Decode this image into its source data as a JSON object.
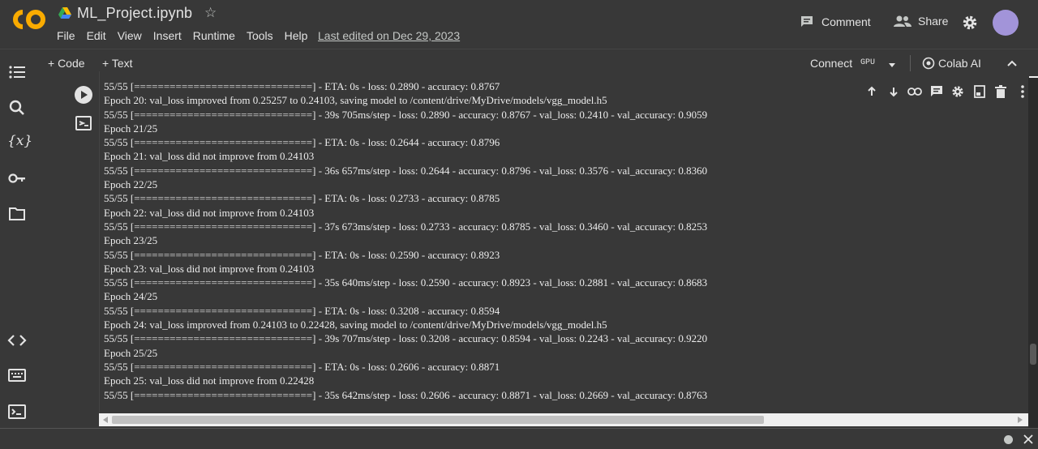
{
  "header": {
    "title": "ML_Project.ipynb",
    "menu": [
      "File",
      "Edit",
      "View",
      "Insert",
      "Runtime",
      "Tools",
      "Help"
    ],
    "last_edited": "Last edited on Dec 29, 2023",
    "comment_label": "Comment",
    "share_label": "Share",
    "logo_icon": "colab-logo-icon",
    "accent": "#f9ab00"
  },
  "toolbar": {
    "add_code": "+ Code",
    "add_text": "+ Text",
    "connect": "Connect",
    "runtime_type": "GPU",
    "colab_ai": "Colab AI"
  },
  "cell": {
    "output_lines": [
      "55/55 [==============================] - ETA: 0s - loss: 0.2890 - accuracy: 0.8767",
      "Epoch 20: val_loss improved from 0.25257 to 0.24103, saving model to /content/drive/MyDrive/models/vgg_model.h5",
      "55/55 [==============================] - 39s 705ms/step - loss: 0.2890 - accuracy: 0.8767 - val_loss: 0.2410 - val_accuracy: 0.9059",
      "Epoch 21/25",
      "55/55 [==============================] - ETA: 0s - loss: 0.2644 - accuracy: 0.8796",
      "Epoch 21: val_loss did not improve from 0.24103",
      "55/55 [==============================] - 36s 657ms/step - loss: 0.2644 - accuracy: 0.8796 - val_loss: 0.3576 - val_accuracy: 0.8360",
      "Epoch 22/25",
      "55/55 [==============================] - ETA: 0s - loss: 0.2733 - accuracy: 0.8785",
      "Epoch 22: val_loss did not improve from 0.24103",
      "55/55 [==============================] - 37s 673ms/step - loss: 0.2733 - accuracy: 0.8785 - val_loss: 0.3460 - val_accuracy: 0.8253",
      "Epoch 23/25",
      "55/55 [==============================] - ETA: 0s - loss: 0.2590 - accuracy: 0.8923",
      "Epoch 23: val_loss did not improve from 0.24103",
      "55/55 [==============================] - 35s 640ms/step - loss: 0.2590 - accuracy: 0.8923 - val_loss: 0.2881 - val_accuracy: 0.8683",
      "Epoch 24/25",
      "55/55 [==============================] - ETA: 0s - loss: 0.3208 - accuracy: 0.8594",
      "Epoch 24: val_loss improved from 0.24103 to 0.22428, saving model to /content/drive/MyDrive/models/vgg_model.h5",
      "55/55 [==============================] - 39s 707ms/step - loss: 0.3208 - accuracy: 0.8594 - val_loss: 0.2243 - val_accuracy: 0.9220",
      "Epoch 25/25",
      "55/55 [==============================] - ETA: 0s - loss: 0.2606 - accuracy: 0.8871",
      "Epoch 25: val_loss did not improve from 0.22428",
      "55/55 [==============================] - 35s 642ms/step - loss: 0.2606 - accuracy: 0.8871 - val_loss: 0.2669 - val_accuracy: 0.8763"
    ]
  }
}
